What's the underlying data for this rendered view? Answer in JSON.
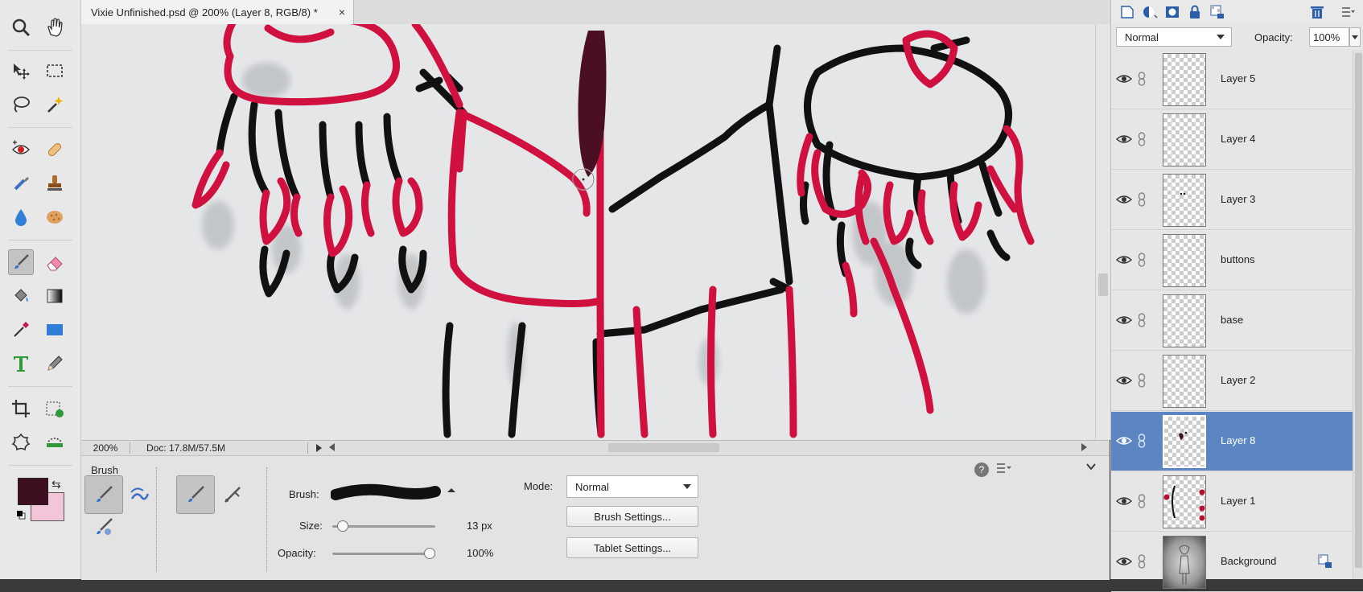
{
  "document": {
    "tab_title": "Vixie Unfinished.psd @ 200% (Layer 8, RGB/8) *",
    "close_glyph": "×",
    "zoom": "200%",
    "doc_size": "Doc: 17.8M/57.5M"
  },
  "toolbox": {
    "tools": [
      "zoom-icon",
      "hand-icon",
      "move-icon",
      "marquee-icon",
      "lasso-icon",
      "magic-wand-icon",
      "red-eye-icon",
      "healing-brush-icon",
      "smart-brush-icon",
      "clone-stamp-icon",
      "blur-icon",
      "sponge-icon",
      "brush-icon",
      "eraser-icon",
      "paint-bucket-icon",
      "gradient-icon",
      "eyedropper-icon",
      "shape-icon",
      "type-icon",
      "pencil-icon",
      "crop-icon",
      "recompose-icon",
      "cookie-cutter-icon",
      "straighten-icon"
    ],
    "active_tool": "brush-icon",
    "foreground_color": "#3d0f20",
    "background_color": "#f2c6d8"
  },
  "tool_options": {
    "panel_title": "Brush",
    "brush_label": "Brush:",
    "size_label": "Size:",
    "size_value": "13 px",
    "size_fraction": 0.03,
    "opacity_label": "Opacity:",
    "opacity_value": "100%",
    "opacity_fraction": 1.0,
    "mode_label": "Mode:",
    "mode_value": "Normal",
    "brush_settings_label": "Brush Settings...",
    "tablet_settings_label": "Tablet Settings..."
  },
  "layers_panel": {
    "blend_mode": "Normal",
    "opacity_label": "Opacity:",
    "opacity_value": "100%",
    "layers": [
      {
        "name": "Layer 5",
        "selected": false
      },
      {
        "name": "Layer 4",
        "selected": false
      },
      {
        "name": "Layer 3",
        "selected": false
      },
      {
        "name": "buttons",
        "selected": false
      },
      {
        "name": "base",
        "selected": false
      },
      {
        "name": "Layer 2",
        "selected": false
      },
      {
        "name": "Layer 8",
        "selected": true
      },
      {
        "name": "Layer 1",
        "selected": false
      },
      {
        "name": "Background",
        "selected": false
      }
    ]
  },
  "colors": {
    "ink_red": "#d0103f",
    "ink_black": "#111111",
    "selection_blue": "#5b86c3",
    "dark_stroke": "#4a0f22"
  }
}
